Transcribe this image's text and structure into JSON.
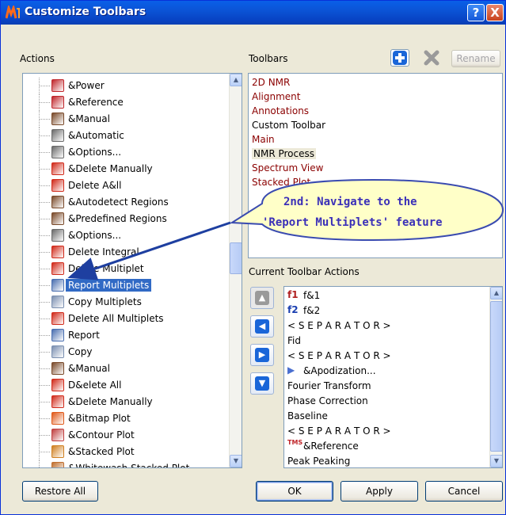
{
  "window": {
    "title": "Customize Toolbars",
    "help_glyph": "?",
    "close_glyph": "X"
  },
  "actions": {
    "label": "Actions",
    "items": [
      {
        "label": "&Power",
        "icon": "power-icon",
        "color": "#c0262b"
      },
      {
        "label": "&Reference",
        "icon": "tms-reference-icon",
        "color": "#c0262b"
      },
      {
        "label": "&Manual",
        "icon": "manual-icon",
        "color": "#7a4a2a"
      },
      {
        "label": "&Automatic",
        "icon": "automatic-icon",
        "color": "#6a6a6a"
      },
      {
        "label": "&Options...",
        "icon": "options-icon",
        "color": "#6a6a6a"
      },
      {
        "label": "&Delete Manually",
        "icon": "delete-manually-icon",
        "color": "#d12a1a"
      },
      {
        "label": "Delete A&ll",
        "icon": "delete-all-icon",
        "color": "#d12a1a"
      },
      {
        "label": "&Autodetect Regions",
        "icon": "autodetect-regions-icon",
        "color": "#7a4a2a"
      },
      {
        "label": "&Predefined Regions",
        "icon": "predefined-regions-icon",
        "color": "#7a4a2a"
      },
      {
        "label": "&Options...",
        "icon": "options-icon",
        "color": "#6a6a6a"
      },
      {
        "label": "Delete Integral",
        "icon": "delete-integral-icon",
        "color": "#d12a1a"
      },
      {
        "label": "Delete Multiplet",
        "icon": "delete-multiplet-icon",
        "color": "#d12a1a"
      },
      {
        "label": "Report Multiplets",
        "icon": "report-multiplets-icon",
        "color": "#4a6fb0"
      },
      {
        "label": "Copy Multiplets",
        "icon": "copy-multiplets-icon",
        "color": "#7a8fb0"
      },
      {
        "label": "Delete All Multiplets",
        "icon": "delete-all-multiplets-icon",
        "color": "#d12a1a"
      },
      {
        "label": "Report",
        "icon": "report-icon",
        "color": "#4a6fb0"
      },
      {
        "label": "Copy",
        "icon": "copy-icon",
        "color": "#7a8fb0"
      },
      {
        "label": "&Manual",
        "icon": "manual-icon",
        "color": "#7a4a2a"
      },
      {
        "label": "D&elete All",
        "icon": "delete-all-icon",
        "color": "#d12a1a"
      },
      {
        "label": "&Delete Manually",
        "icon": "delete-manually-icon",
        "color": "#d12a1a"
      },
      {
        "label": "&Bitmap Plot",
        "icon": "bitmap-plot-icon",
        "color": "#e05a1a"
      },
      {
        "label": "&Contour Plot",
        "icon": "contour-plot-icon",
        "color": "#c04040"
      },
      {
        "label": "&Stacked Plot",
        "icon": "stacked-plot-icon",
        "color": "#d08020"
      },
      {
        "label": "&Whitewash Stacked Plot",
        "icon": "whitewash-stacked-plot-icon",
        "color": "#c07030"
      }
    ],
    "selected_index": 12
  },
  "toolbars": {
    "label": "Toolbars",
    "rename_label": "Rename",
    "items": [
      {
        "label": "2D NMR",
        "color": "#8b0000"
      },
      {
        "label": "Alignment",
        "color": "#8b0000"
      },
      {
        "label": "Annotations",
        "color": "#8b0000"
      },
      {
        "label": "Custom Toolbar",
        "color": "#000000"
      },
      {
        "label": "Main",
        "color": "#8b0000"
      },
      {
        "label": "NMR Process",
        "color": "#000000"
      },
      {
        "label": "Spectrum View",
        "color": "#8b0000"
      },
      {
        "label": "Stacked Plot",
        "color": "#8b0000"
      }
    ],
    "selected_index": 5
  },
  "current_actions": {
    "label": "Current Toolbar Actions",
    "items": [
      {
        "label": "f&1",
        "icon": "f1"
      },
      {
        "label": "f&2",
        "icon": "f2"
      },
      {
        "label": "< S E P A R A T O R >",
        "icon": ""
      },
      {
        "label": "Fid",
        "icon": ""
      },
      {
        "label": "< S E P A R A T O R >",
        "icon": ""
      },
      {
        "label": "&Apodization...",
        "icon": "apodization"
      },
      {
        "label": "Fourier Transform",
        "icon": ""
      },
      {
        "label": "Phase Correction",
        "icon": ""
      },
      {
        "label": "Baseline",
        "icon": ""
      },
      {
        "label": "< S E P A R A T O R >",
        "icon": ""
      },
      {
        "label": "&Reference",
        "icon": "tms"
      },
      {
        "label": "Peak Peaking",
        "icon": ""
      }
    ]
  },
  "buttons": {
    "restore_all": "Restore All",
    "ok": "OK",
    "apply": "Apply",
    "cancel": "Cancel"
  },
  "callout": {
    "line1": "2nd: Navigate to the",
    "line2": "'Report Multiplets' feature",
    "fill_color": "#ffffc8",
    "text_color": "#3a2fb8",
    "arrow_color": "#1e3fa0"
  },
  "colors": {
    "accent": "#316ac5",
    "title_bar": "#0b54d6",
    "dialog_bg": "#ece9d8"
  }
}
